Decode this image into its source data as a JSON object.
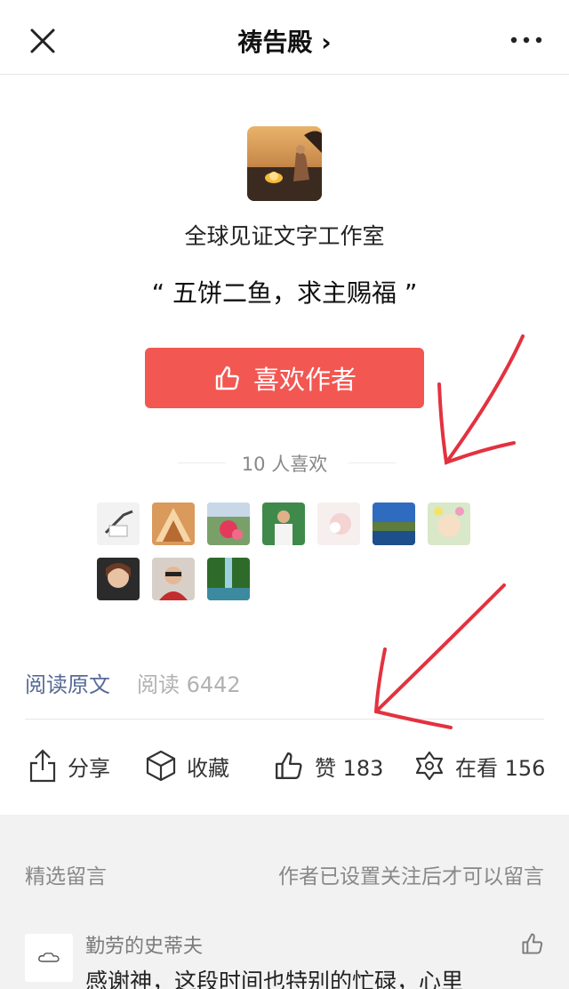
{
  "header": {
    "title": "祷告殿 ›"
  },
  "profile": {
    "author_name": "全球见证文字工作室",
    "quote": "“ 五饼二鱼，求主赐福 ”"
  },
  "like_author": {
    "label": "喜欢作者",
    "count_text": "10 人喜欢"
  },
  "fans": [
    "fan-1",
    "fan-2",
    "fan-3",
    "fan-4",
    "fan-5",
    "fan-6",
    "fan-7",
    "fan-8",
    "fan-9",
    "fan-10"
  ],
  "read": {
    "original_label": "阅读原文",
    "count_text": "阅读 6442"
  },
  "actions": {
    "share": "分享",
    "favorite": "收藏",
    "like": "赞 183",
    "watching": "在看 156"
  },
  "comments": {
    "section_title": "精选留言",
    "notice": "作者已设置关注后才可以留言",
    "items": [
      {
        "name": "勤劳的史蒂夫",
        "text": "感谢神，这段时间也特别的忙碌，心里"
      }
    ]
  },
  "colors": {
    "accent_red": "#f25752",
    "link_blue": "#576b95",
    "annotation_red": "#e3323f"
  }
}
